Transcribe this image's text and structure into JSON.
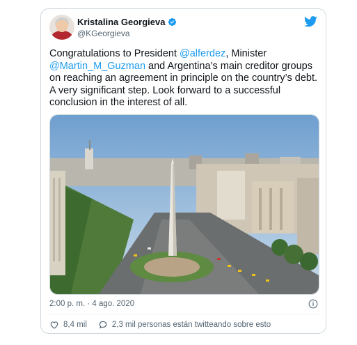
{
  "author": {
    "name": "Kristalina Georgieva",
    "handle": "@KGeorgieva"
  },
  "tweet": {
    "text_1": "Congratulations to President ",
    "mention_1": "@alferdez",
    "text_2": ", Minister ",
    "mention_2": "@Martin_M_Guzman",
    "text_3": " and Argentina’s main creditor groups on reaching an agreement in principle on the country’s debt. A very significant step. Look forward to a successful conclusion in the interest of all."
  },
  "meta": {
    "timestamp": "2:00 p. m. · 4 ago. 2020"
  },
  "actions": {
    "likes": "8,4 mil",
    "conversation": "2,3 mil personas están twitteando sobre esto"
  },
  "icons": {
    "verified": "verified-badge-icon",
    "twitter": "twitter-bird-icon",
    "info": "info-icon",
    "like": "heart-icon",
    "reply": "speech-bubble-icon"
  },
  "colors": {
    "accent": "#1d9bf0",
    "text": "#0f1419",
    "muted": "#536471"
  }
}
